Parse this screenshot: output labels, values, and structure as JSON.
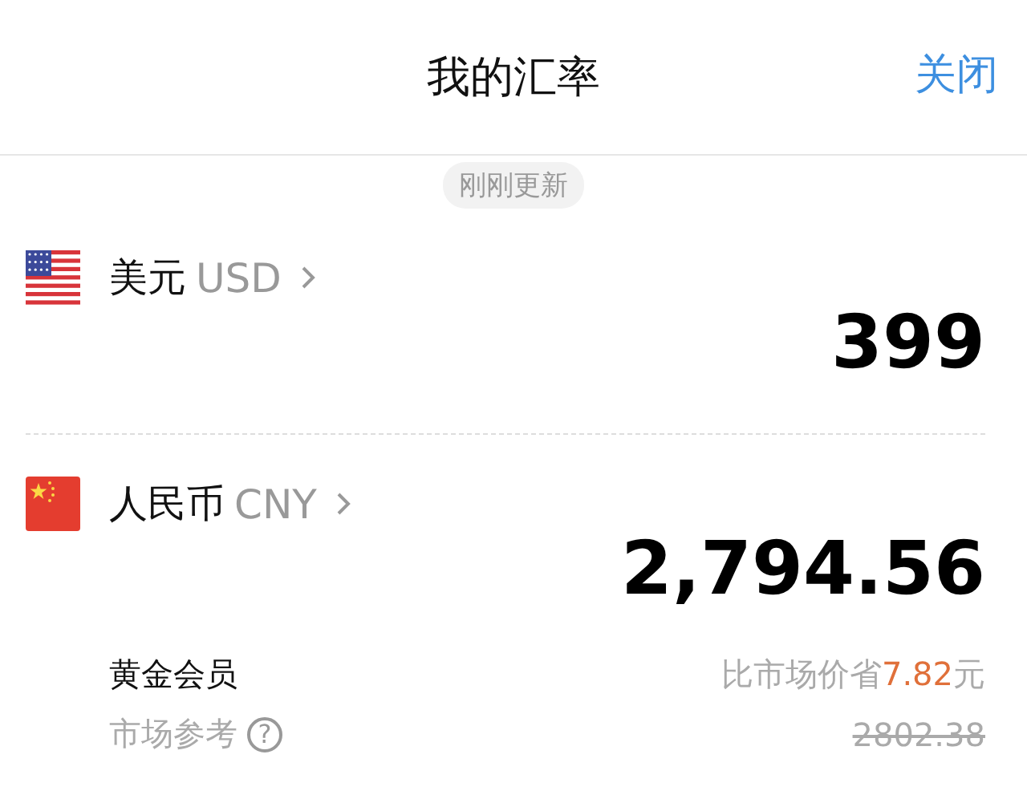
{
  "header": {
    "title": "我的汇率",
    "close": "关闭"
  },
  "update_badge": "刚刚更新",
  "currencies": [
    {
      "kind": "us",
      "name": "美元",
      "code": "USD",
      "amount": "399"
    },
    {
      "kind": "cn",
      "name": "人民币",
      "code": "CNY",
      "amount": "2,794.56"
    }
  ],
  "member": {
    "label": "黄金会员",
    "market_label": "市场参考",
    "help": "?",
    "savings_prefix": "比市场价省",
    "savings_amount": "7.82",
    "savings_suffix": "元",
    "market_price": "2802.38"
  }
}
